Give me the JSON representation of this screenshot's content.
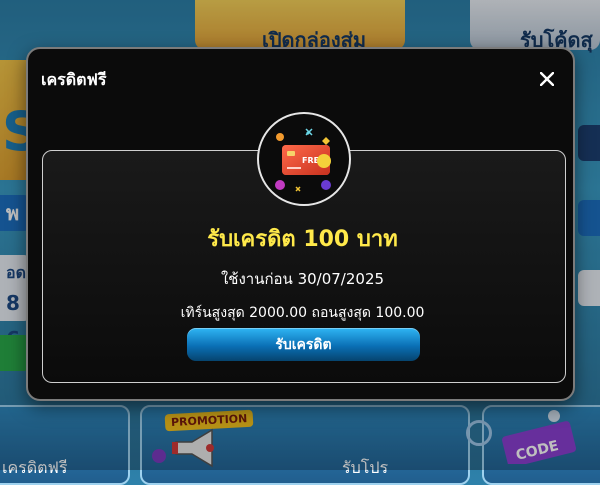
{
  "modal": {
    "title": "เครดิตฟรี",
    "reward_title": "รับเครดิต 100 บาท",
    "expiry_text": "ใช้งานก่อน 30/07/2025",
    "limits_text": "เทิร์นสูงสุด 2000.00 ถอนสูงสุด 100.00",
    "claim_button_label": "รับเครดิต",
    "badge_card_text": "FREE",
    "close_icon": "close-icon",
    "accent_color": "#ffe94a",
    "button_color": "#0a6fb5"
  },
  "background": {
    "top_card_1_text": "เปิดกล่องสุ่ม",
    "top_card_2_text": "รับโค้ดสุ",
    "left_strip_1": "พ",
    "left_strip_2": "อด",
    "left_strip_3": "8 6",
    "promo_tag": "PROMOTION",
    "bottom_label_1": "เครดิตฟรี",
    "bottom_label_2": "รับโปร",
    "code_tag": "CODE"
  }
}
